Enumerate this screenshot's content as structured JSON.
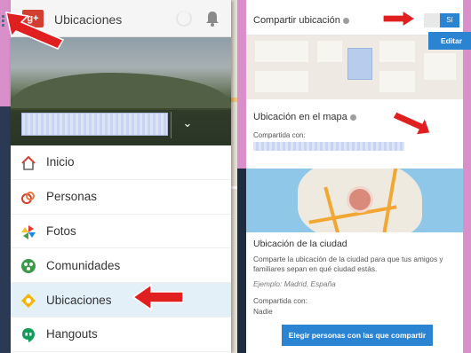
{
  "left_panel": {
    "header": {
      "logo_label": "g+",
      "title": "Ubicaciones"
    },
    "menu": [
      {
        "label": "Inicio",
        "icon": "home-icon"
      },
      {
        "label": "Personas",
        "icon": "people-icon"
      },
      {
        "label": "Fotos",
        "icon": "photos-icon"
      },
      {
        "label": "Comunidades",
        "icon": "communities-icon"
      },
      {
        "label": "Ubicaciones",
        "icon": "location-icon",
        "active": true
      },
      {
        "label": "Hangouts",
        "icon": "hangouts-icon"
      }
    ]
  },
  "right_panel": {
    "share_location": {
      "label": "Compartir ubicación",
      "toggle_value": "Sí"
    },
    "map_location": {
      "title": "Ubicación en el mapa",
      "shared_with_label": "Compartida con:",
      "edit_button": "Editar"
    },
    "city_location": {
      "title": "Ubicación de la ciudad",
      "description": "Comparte la ubicación de la ciudad para que tus amigos y familiares sepan en qué ciudad estás.",
      "example": "Ejemplo: Madrid, España",
      "shared_with_label": "Compartida con:",
      "shared_with_value": "Nadie",
      "choose_button": "Elegir personas con las que compartir"
    }
  },
  "colors": {
    "accent_blue": "#2a84d2",
    "annotation_red": "#e02020",
    "gplus_red": "#d23f31",
    "background_pink": "#d98fc9"
  }
}
